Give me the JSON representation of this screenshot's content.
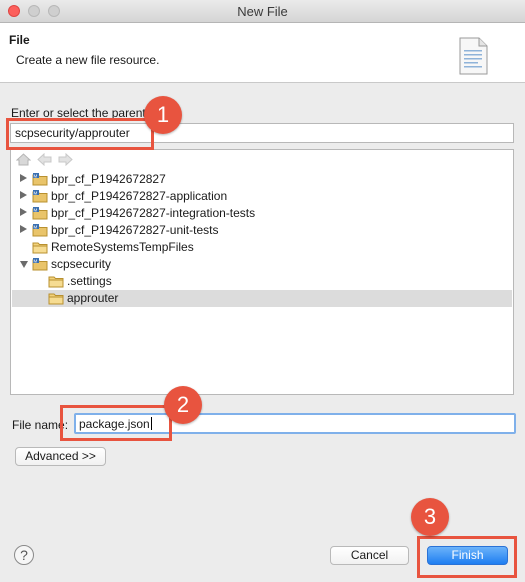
{
  "window": {
    "title": "New File"
  },
  "header": {
    "title": "File",
    "description": "Create a new file resource."
  },
  "parent": {
    "label": "Enter or select the parent",
    "value": "scpsecurity/approuter"
  },
  "tree": {
    "items": [
      {
        "label": "bpr_cf_P1942672827",
        "expander": "collapsed",
        "icon": "project-icon"
      },
      {
        "label": "bpr_cf_P1942672827-application",
        "expander": "collapsed",
        "icon": "project-icon"
      },
      {
        "label": "bpr_cf_P1942672827-integration-tests",
        "expander": "collapsed",
        "icon": "project-icon"
      },
      {
        "label": "bpr_cf_P1942672827-unit-tests",
        "expander": "collapsed",
        "icon": "project-icon"
      },
      {
        "label": "RemoteSystemsTempFiles",
        "expander": "none",
        "icon": "folder-icon"
      },
      {
        "label": "scpsecurity",
        "expander": "expanded",
        "icon": "project-icon"
      },
      {
        "label": ".settings",
        "expander": "none",
        "icon": "folder-icon"
      },
      {
        "label": "approuter",
        "expander": "none",
        "icon": "folder-icon",
        "selected": true
      }
    ]
  },
  "file_name": {
    "label": "File name:",
    "value": "package.json"
  },
  "buttons": {
    "advanced": "Advanced >>",
    "cancel": "Cancel",
    "finish": "Finish"
  },
  "callouts": [
    "1",
    "2",
    "3"
  ],
  "colors": {
    "callout": "#e8543f",
    "primary": "#1f7ef1",
    "selection": "#dcdcdc"
  }
}
